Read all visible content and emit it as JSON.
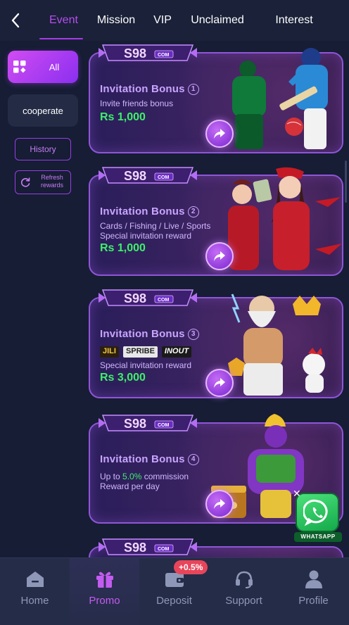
{
  "tabs": [
    "Event",
    "Mission",
    "VIP",
    "Unclaimed",
    "Interest"
  ],
  "sidebar": {
    "all_label": "All",
    "coop_label": "cooperate",
    "history_label": "History",
    "refresh_label": "Refresh rewards"
  },
  "badge_text": "S98",
  "badge_com": "COM",
  "cards": [
    {
      "title": "Invitation Bonus",
      "num": "1",
      "lines": [
        "Invite friends bonus"
      ],
      "amount": "Rs 1,000"
    },
    {
      "title": "Invitation Bonus",
      "num": "2",
      "lines": [
        "Cards / Fishing / Live / Sports",
        "Special invitation reward"
      ],
      "amount": "Rs 1,000"
    },
    {
      "title": "Invitation Bonus",
      "num": "3",
      "logos": [
        "JILI",
        "SPRIBE",
        "INOUT"
      ],
      "lines": [
        "Special invitation reward"
      ],
      "amount": "Rs 3,000"
    },
    {
      "title": "Invitation Bonus",
      "num": "4",
      "line_prefix": "Up to ",
      "line_highlight": "5.0%",
      "line_suffix": " commission",
      "lines": [
        "Reward per day"
      ]
    }
  ],
  "whatsapp_label": "WHATSAPP",
  "nav": [
    "Home",
    "Promo",
    "Deposit",
    "Support",
    "Profile"
  ],
  "deposit_badge": "+0.5%",
  "colors": {
    "accent": "#a63be8",
    "amount": "#3df06a",
    "title": "#c9a4ff"
  }
}
